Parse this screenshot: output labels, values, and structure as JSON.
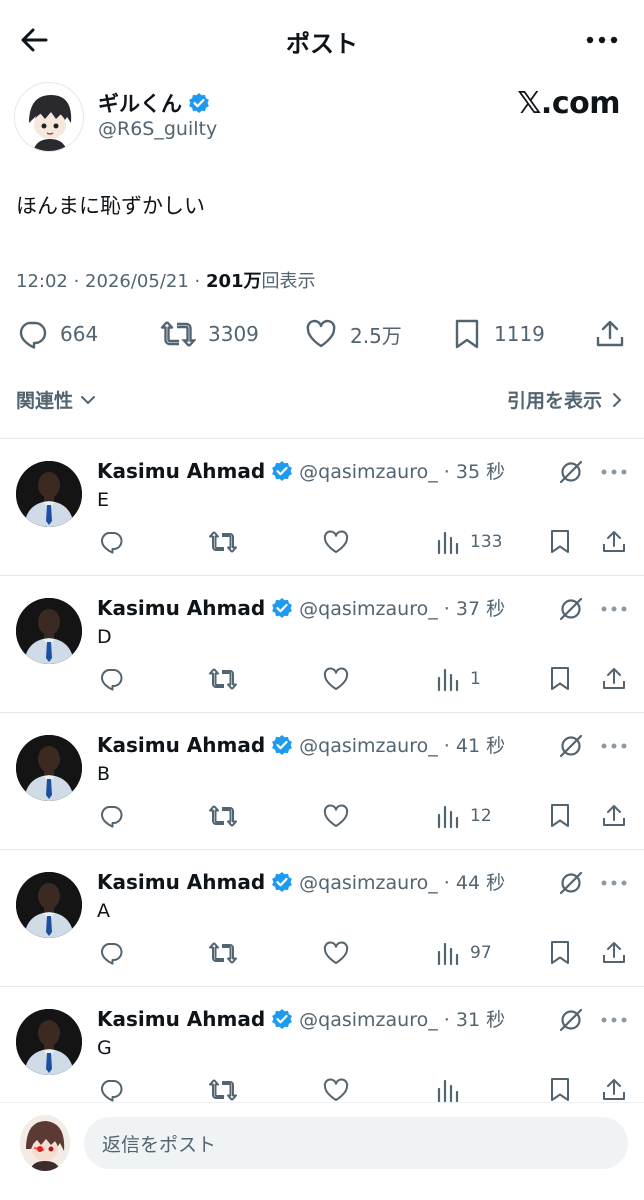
{
  "header": {
    "title": "ポスト"
  },
  "author": {
    "name": "ギルくん",
    "handle": "@R6S_guilty",
    "brand": "𝕏.com"
  },
  "post": {
    "text": "ほんまに恥ずかしい",
    "time": "12:02 · 2026/05/21 · ",
    "views_count": "201万",
    "views_label": "回表示"
  },
  "stats": {
    "replies": "664",
    "reposts": "3309",
    "likes": "2.5万",
    "bookmarks": "1119"
  },
  "sort": {
    "label": "関連性",
    "quotes_link": "引用を表示"
  },
  "replies": [
    {
      "name": "Kasimu Ahmad",
      "handle": "@qasimzauro_ · 35 秒",
      "text": "E",
      "views": "133"
    },
    {
      "name": "Kasimu Ahmad",
      "handle": "@qasimzauro_ · 37 秒",
      "text": "D",
      "views": "1"
    },
    {
      "name": "Kasimu Ahmad",
      "handle": "@qasimzauro_ · 41 秒",
      "text": "B",
      "views": "12"
    },
    {
      "name": "Kasimu Ahmad",
      "handle": "@qasimzauro_ · 44 秒",
      "text": "A",
      "views": "97"
    },
    {
      "name": "Kasimu Ahmad",
      "handle": "@qasimzauro_ · 31 秒",
      "text": "G",
      "views": ""
    }
  ],
  "composer": {
    "placeholder": "返信をポスト"
  },
  "colors": {
    "verified": "#1d9bf0",
    "secondary_text": "#536471",
    "text": "#0f1419"
  }
}
